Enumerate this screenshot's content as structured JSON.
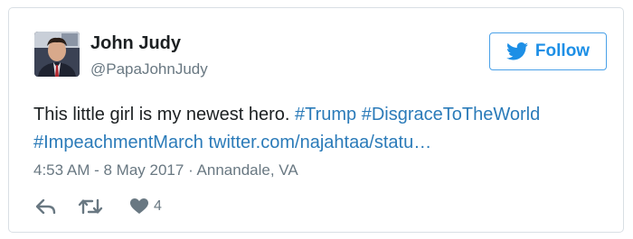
{
  "user": {
    "display_name": "John Judy",
    "screen_name": "@PapaJohnJudy"
  },
  "follow_button": {
    "label": "Follow",
    "icon": "twitter-bird-icon"
  },
  "tweet": {
    "text": "This little girl is my newest hero.",
    "hashtags": [
      "#Trump",
      "#DisgraceToTheWorld",
      "#ImpeachmentMarch"
    ],
    "link": "twitter.com/najahtaa/statu…",
    "time": "4:53 AM - 8 May 2017",
    "separator": "·",
    "location": "Annandale, VA"
  },
  "actions": {
    "reply_icon": "reply-icon",
    "retweet_icon": "retweet-icon",
    "like_icon": "heart-icon",
    "like_count": "4"
  },
  "colors": {
    "accent": "#1d8fe6",
    "link": "#2b7bb9",
    "muted": "#697882",
    "border": "#d9dfe4"
  }
}
